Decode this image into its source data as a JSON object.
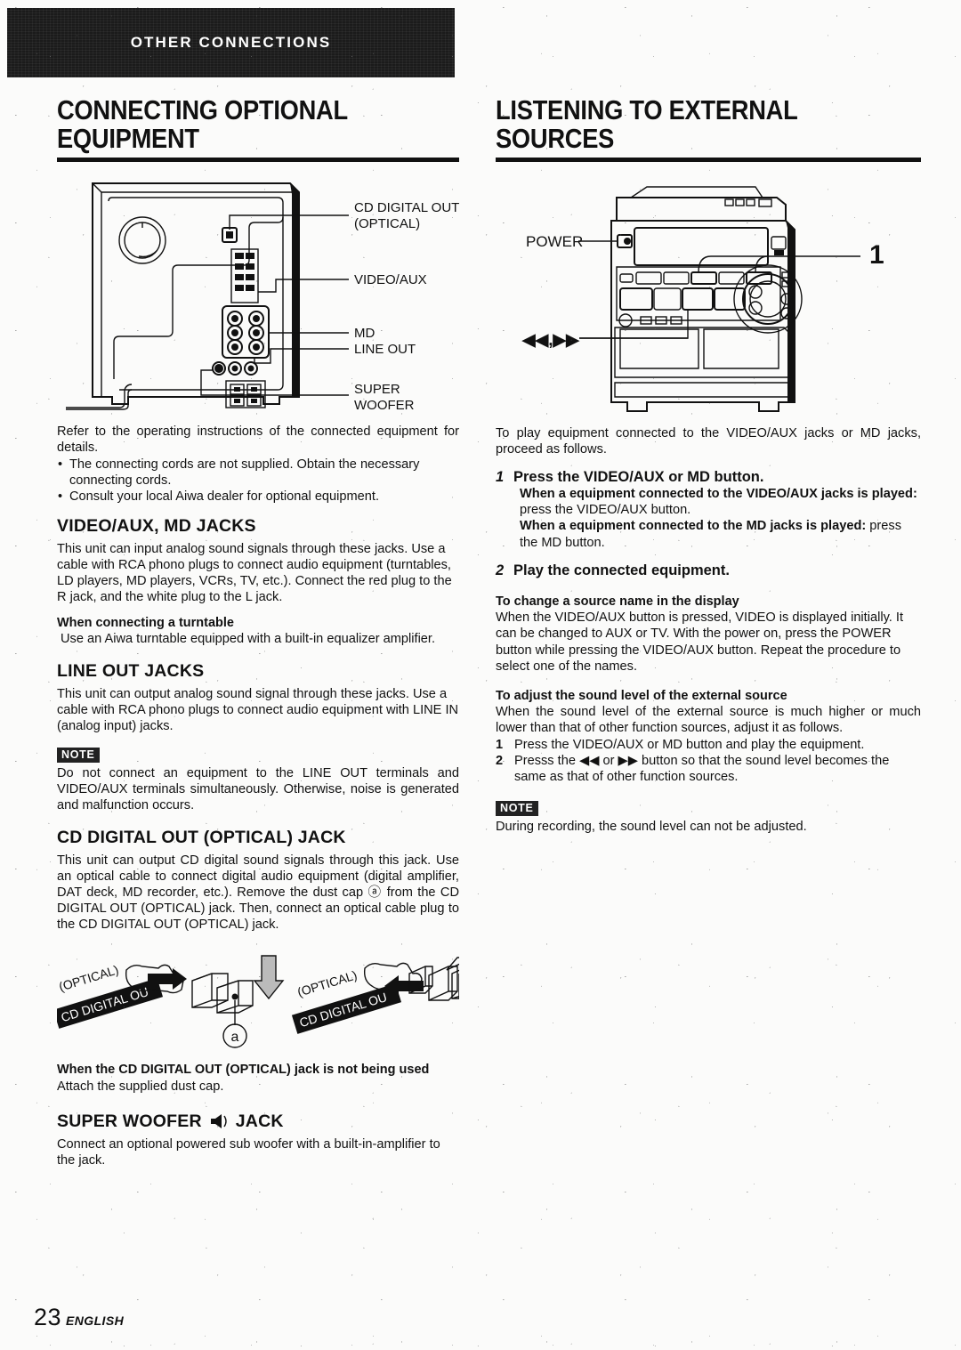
{
  "banner": {
    "label": "OTHER CONNECTIONS"
  },
  "left": {
    "title": "CONNECTING OPTIONAL EQUIPMENT",
    "title_line1": "CONNECTING OPTIONAL",
    "title_line2": "EQUIPMENT",
    "diagram": {
      "name": "rear-panel-connections",
      "callouts": [
        "CD DIGITAL OUT",
        "(OPTICAL)",
        "VIDEO/AUX",
        "MD",
        "LINE OUT",
        "SUPER",
        "WOOFER"
      ]
    },
    "intro": "Refer to the operating instructions of the connected equipment for details.",
    "bullets": [
      "The connecting cords are not supplied. Obtain the necessary connecting cords.",
      "Consult your local Aiwa dealer for optional equipment."
    ],
    "section_videoaux": {
      "heading": "VIDEO/AUX, MD JACKS",
      "body": "This unit can input analog sound signals through these jacks. Use a cable with RCA phono plugs to connect audio equipment (turntables, LD players, MD players, VCRs, TV, etc.). Connect the red plug to the R jack, and the white plug to the L jack.",
      "turntable_heading": "When connecting a turntable",
      "turntable_body": "Use an Aiwa turntable equipped with a built-in equalizer amplifier."
    },
    "section_lineout": {
      "heading": "LINE OUT JACKS",
      "body": "This unit can output analog sound signal through these jacks. Use a cable with RCA phono plugs to connect audio equipment with LINE IN (analog input) jacks.",
      "note_label": "NOTE",
      "note_body": "Do not connect an equipment to the LINE OUT terminals and VIDEO/AUX terminals simultaneously. Otherwise, noise is generated and malfunction occurs."
    },
    "section_cddigital": {
      "heading": "CD DIGITAL OUT (OPTICAL) JACK",
      "body": "This unit can output CD digital sound signals through this jack. Use an optical cable to connect digital audio equipment (digital amplifier, DAT deck, MD recorder, etc.). Remove the dust cap ⓐ from the CD DIGITAL OUT (OPTICAL) jack. Then, connect an optical cable plug to the CD DIGITAL OUT (OPTICAL) jack.",
      "figure": {
        "name": "optical-cable-connection",
        "label_optical": "(OPTICAL)",
        "label_jack": "CD DIGITAL OU",
        "callout_a": "a"
      },
      "notused_heading": "When the CD DIGITAL OUT (OPTICAL) jack is not being used",
      "notused_body": "Attach the supplied dust cap."
    },
    "section_woofer": {
      "heading_pre": "SUPER WOOFER",
      "heading_post": "JACK",
      "icon": "speaker-icon",
      "body": "Connect an optional powered sub woofer with a built-in-amplifier to the jack."
    }
  },
  "right": {
    "title": "LISTENING TO EXTERNAL SOURCES",
    "title_line1": "LISTENING TO EXTERNAL",
    "title_line2": "SOURCES",
    "diagram": {
      "name": "front-panel-controls",
      "callouts": [
        "POWER",
        "◀◀,▶▶",
        "1"
      ]
    },
    "intro": "To play equipment connected to the VIDEO/AUX jacks or MD jacks, proceed as follows.",
    "steps": [
      {
        "num": "1",
        "title": "Press the VIDEO/AUX or MD button.",
        "detail_a_bold": "When a equipment connected to the VIDEO/AUX jacks is played:",
        "detail_a_rest": " press the VIDEO/AUX button.",
        "detail_b_bold": "When a equipment connected to the MD jacks is played:",
        "detail_b_rest": " press the MD button."
      },
      {
        "num": "2",
        "title": "Play the connected equipment."
      }
    ],
    "change_source": {
      "heading": "To change a source name in the display",
      "body": "When the VIDEO/AUX button is pressed, VIDEO is displayed initially.  It can be changed to AUX or TV. With the power on, press the POWER button while pressing the VIDEO/AUX button. Repeat the procedure to select one of the names."
    },
    "adjust_level": {
      "heading": "To adjust the sound level of the external source",
      "body": "When the sound level of the external source is much higher or much lower than that of other function sources, adjust it as follows.",
      "items": [
        {
          "n": "1",
          "text": "Press the VIDEO/AUX or MD button and play the equipment."
        },
        {
          "n": "2",
          "text": "Presss the ◀◀ or ▶▶ button so that the sound level becomes the same as that of other function sources."
        }
      ],
      "note_label": "NOTE",
      "note_body": "During recording, the sound level can not be adjusted."
    }
  },
  "footer": {
    "page": "23",
    "language": "ENGLISH"
  }
}
